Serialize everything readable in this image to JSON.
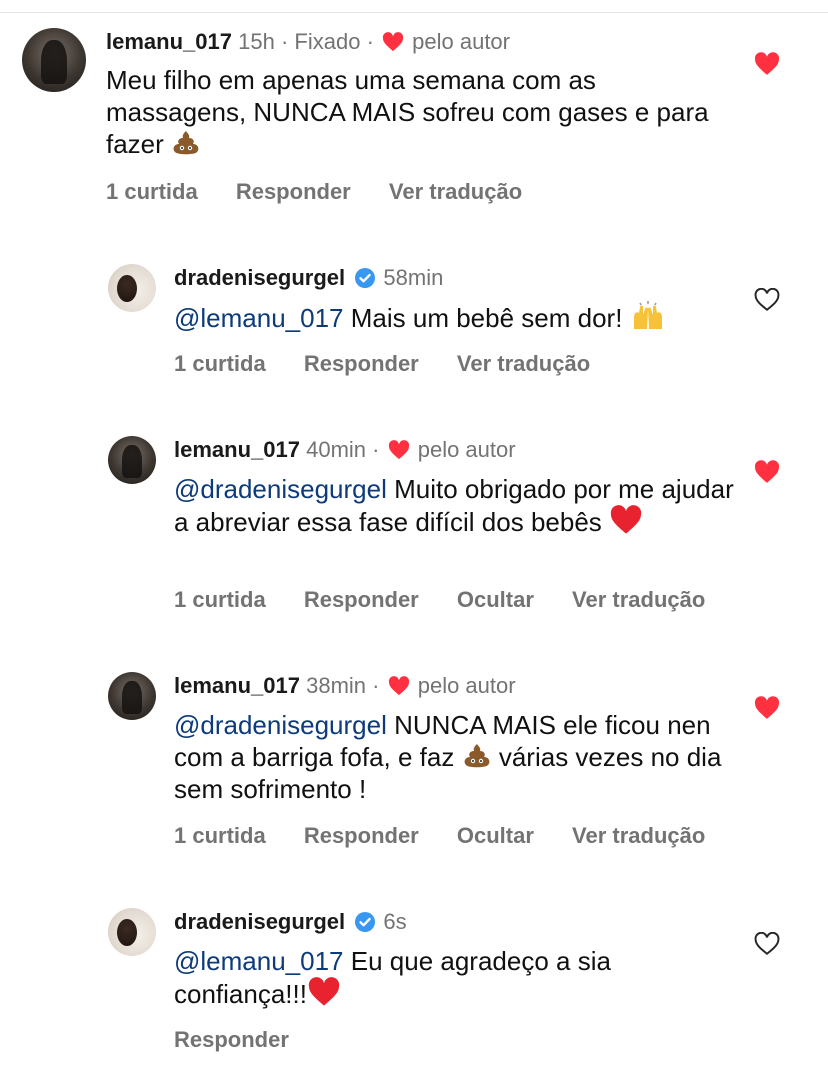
{
  "comments": [
    {
      "username": "lemanu_017",
      "time": "15h",
      "pinned": "Fixado",
      "author_like": "pelo autor",
      "text": "Meu filho em apenas uma semana com as massagens, NUNCA MAIS  sofreu com gases e para fazer",
      "emoji": "poop",
      "likes": "1 curtida",
      "reply": "Responder",
      "translate": "Ver tradução",
      "liked": true
    },
    {
      "username": "dradenisegurgel",
      "verified": true,
      "time": "58min",
      "mention": "@lemanu_017",
      "text": "Mais um bebê sem dor!",
      "emoji": "raised-hands",
      "likes": "1 curtida",
      "reply": "Responder",
      "translate": "Ver tradução",
      "liked": false
    },
    {
      "username": "lemanu_017",
      "time": "40min",
      "author_like": "pelo autor",
      "mention": "@dradenisegurgel",
      "text": "Muito obrigado por me ajudar a abreviar essa fase difícil  dos bebês",
      "emoji": "red-heart",
      "likes": "1 curtida",
      "reply": "Responder",
      "hide": "Ocultar",
      "translate": "Ver tradução",
      "liked": true
    },
    {
      "username": "lemanu_017",
      "time": "38min",
      "author_like": "pelo autor",
      "mention": "@dradenisegurgel",
      "text_before": "NUNCA MAIS ele ficou nen com a barriga fofa, e faz",
      "emoji": "poop",
      "text_after": "várias vezes no dia sem sofrimento !",
      "likes": "1 curtida",
      "reply": "Responder",
      "hide": "Ocultar",
      "translate": "Ver tradução",
      "liked": true
    },
    {
      "username": "dradenisegurgel",
      "verified": true,
      "time": "6s",
      "mention": "@lemanu_017",
      "text": "Eu que agradeço a sia confiança!!!",
      "emoji": "red-heart",
      "reply": "Responder",
      "liked": false
    }
  ],
  "separator": "·",
  "colors": {
    "heart": "#ff3040",
    "verified": "#3897f0",
    "mention": "#0d3b7a",
    "muted": "#737373"
  }
}
